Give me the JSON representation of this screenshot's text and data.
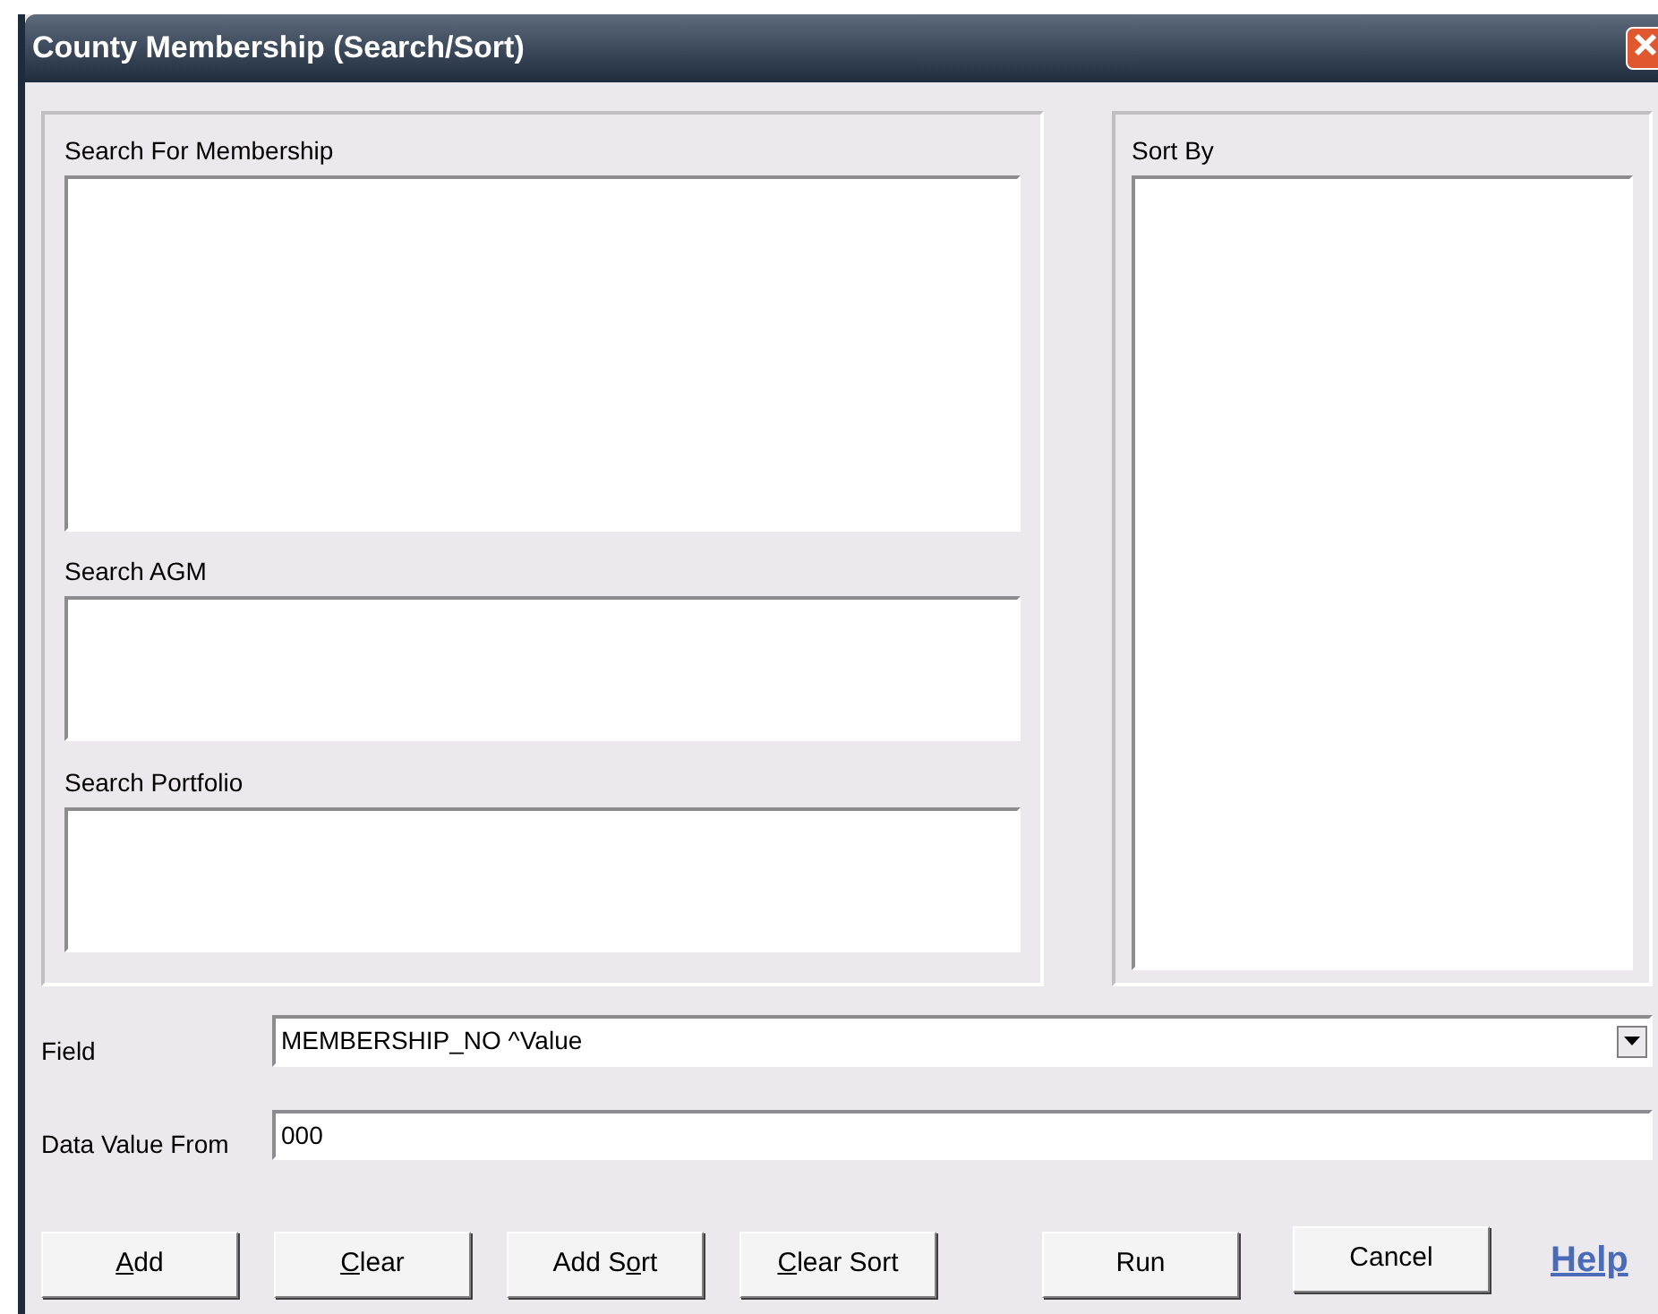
{
  "window": {
    "title": "County Membership (Search/Sort)"
  },
  "search_lists": [
    {
      "label": "Search For Membership"
    },
    {
      "label": "Search AGM"
    },
    {
      "label": "Search Portfolio"
    }
  ],
  "sort_list": {
    "label": "Sort By"
  },
  "field": {
    "label": "Field",
    "value": "MEMBERSHIP_NO ^Value"
  },
  "data_value_from": {
    "label": "Data Value From",
    "value": "000"
  },
  "buttons": [
    {
      "label_parts": [
        {
          "text": "A",
          "underlined": true
        },
        {
          "text": "dd",
          "underlined": false
        }
      ]
    },
    {
      "label_parts": [
        {
          "text": "C",
          "underlined": true
        },
        {
          "text": "lear",
          "underlined": false
        }
      ]
    },
    {
      "label_parts": [
        {
          "text": "Add S",
          "underlined": false
        },
        {
          "text": "o",
          "underlined": true
        },
        {
          "text": "rt",
          "underlined": false
        }
      ]
    },
    {
      "label_parts": [
        {
          "text": "C",
          "underlined": true
        },
        {
          "text": "lear Sort",
          "underlined": false
        }
      ]
    },
    {
      "label_parts": [
        {
          "text": "Run",
          "underlined": false
        }
      ]
    },
    {
      "label_parts": [
        {
          "text": "Cancel",
          "underlined": false
        }
      ]
    }
  ],
  "help_link": "Help"
}
